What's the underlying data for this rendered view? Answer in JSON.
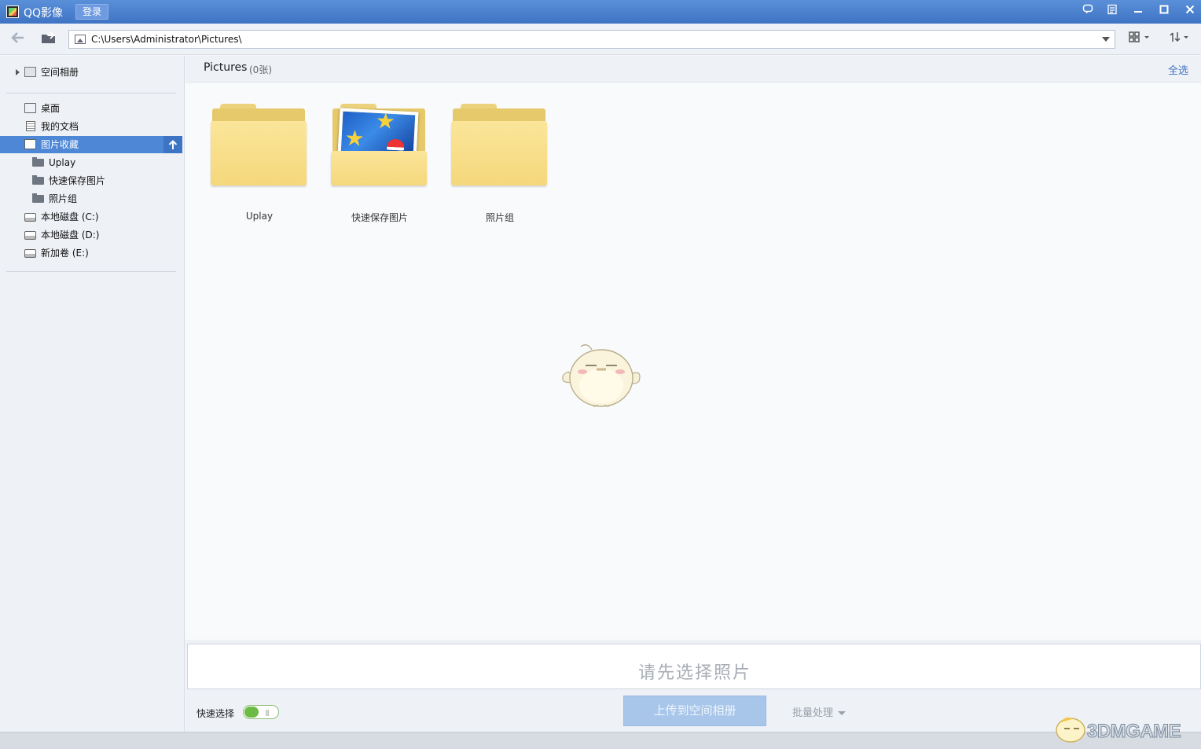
{
  "app": {
    "title": "QQ影像",
    "login_label": "登录"
  },
  "window_controls": {
    "feedback": "feedback-icon",
    "menu": "menu-icon",
    "minimize": "minimize-icon",
    "maximize": "maximize-icon",
    "close": "close-icon"
  },
  "address_bar": {
    "path": "C:\\Users\\Administrator\\Pictures\\"
  },
  "sidebar": {
    "album": {
      "label": "空间相册"
    },
    "items": [
      {
        "label": "桌面",
        "icon": "desktop-icon"
      },
      {
        "label": "我的文档",
        "icon": "document-icon"
      },
      {
        "label": "图片收藏",
        "icon": "pictures-icon",
        "selected": true
      },
      {
        "label": "Uplay",
        "icon": "folder-icon"
      },
      {
        "label": "快速保存图片",
        "icon": "folder-icon"
      },
      {
        "label": "照片组",
        "icon": "folder-icon"
      },
      {
        "label": "本地磁盘 (C:)",
        "icon": "disk-icon"
      },
      {
        "label": "本地磁盘 (D:)",
        "icon": "disk-icon"
      },
      {
        "label": "新加卷 (E:)",
        "icon": "disk-icon"
      }
    ]
  },
  "main": {
    "title": "Pictures",
    "count": "(0张)",
    "select_all": "全选",
    "folders": [
      {
        "name": "Uplay"
      },
      {
        "name": "快速保存图片"
      },
      {
        "name": "照片组"
      }
    ]
  },
  "bottom": {
    "hint": "请先选择照片",
    "quick_select_label": "快速选择",
    "quick_select_on": true,
    "upload_label": "上传到空间相册",
    "batch_label": "批量处理"
  },
  "watermark": {
    "text": "3DMGAME"
  },
  "colors": {
    "accent": "#4e87d6",
    "titlebar": "#3f74c4",
    "toggle_on": "#6cbb45"
  }
}
